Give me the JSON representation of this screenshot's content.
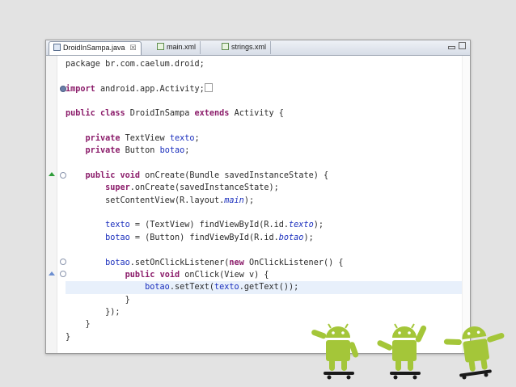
{
  "tabs": [
    {
      "label": "DroidInSampa.java",
      "close": "☒"
    },
    {
      "label": "main.xml"
    },
    {
      "label": "strings.xml"
    }
  ],
  "code": {
    "l1": {
      "a": "package br.com.caelum.droid;"
    },
    "l3": {
      "kw": "import",
      "a": " android.app.Activity;"
    },
    "l5": {
      "kw1": "public",
      "s1": " ",
      "kw2": "class",
      "s2": " DroidInSampa ",
      "kw3": "extends",
      "s3": " Activity {"
    },
    "l7": {
      "i": "    ",
      "kw": "private",
      "a": " TextView ",
      "f": "texto",
      "b": ";"
    },
    "l8": {
      "i": "    ",
      "kw": "private",
      "a": " Button ",
      "f": "botao",
      "b": ";"
    },
    "l10": {
      "i": "    ",
      "kw1": "public",
      "s1": " ",
      "kw2": "void",
      "a": " onCreate(Bundle savedInstanceState) {"
    },
    "l11": {
      "i": "        ",
      "kw": "super",
      "a": ".onCreate(savedInstanceState);"
    },
    "l12": {
      "i": "        ",
      "a": "setContentView(R.layout.",
      "f": "main",
      "b": ");"
    },
    "l14": {
      "i": "        ",
      "f": "texto",
      "a": " = (TextView) findViewById(R.id.",
      "f2": "texto",
      "b": ");"
    },
    "l15": {
      "i": "        ",
      "f": "botao",
      "a": " = (Button) findViewById(R.id.",
      "f2": "botao",
      "b": ");"
    },
    "l17": {
      "i": "        ",
      "f": "botao",
      "a": ".setOnClickListener(",
      "kw": "new",
      "b": " OnClickListener() {"
    },
    "l18": {
      "i": "            ",
      "kw1": "public",
      "s1": " ",
      "kw2": "void",
      "a": " onClick(View v) {"
    },
    "l19": {
      "i": "                ",
      "f": "botao",
      "a": ".setText(",
      "f2": "texto",
      "b": ".getText());"
    },
    "l20": {
      "i": "            ",
      "a": "}"
    },
    "l21": {
      "i": "        ",
      "a": "});"
    },
    "l22": {
      "i": "    ",
      "a": "}"
    },
    "l23": {
      "a": "}"
    }
  },
  "colors": {
    "keyword": "#8b1c6a",
    "field": "#1b2fbd",
    "android_green": "#a4c639"
  },
  "icons": [
    "java-file-icon",
    "xml-file-icon",
    "close-icon",
    "minimize-icon",
    "maximize-icon",
    "fold-marker-icon",
    "override-marker-icon",
    "android-robot-icon"
  ]
}
